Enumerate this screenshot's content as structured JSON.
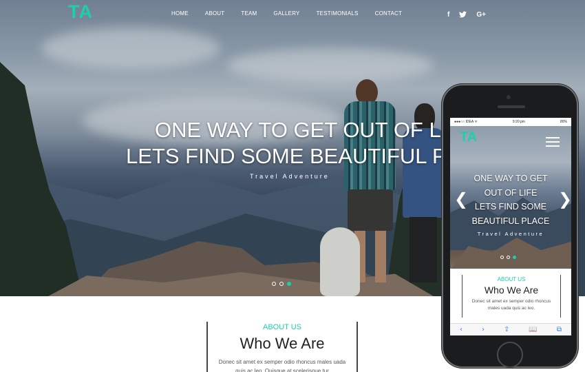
{
  "brand": {
    "logo": "TA",
    "accent": "#1dcfae"
  },
  "nav": {
    "items": [
      "HOME",
      "ABOUT",
      "TEAM",
      "GALLERY",
      "TESTIMONIALS",
      "CONTACT"
    ]
  },
  "social": {
    "facebook": "f",
    "twitter": "🐦",
    "googleplus": "G+"
  },
  "hero": {
    "line1": "ONE WAY TO GET OUT OF LIF",
    "line2": "LETS FIND SOME BEAUTIFUL PLA",
    "subtitle": "Travel Adventure",
    "slides": 3,
    "active_slide": 3
  },
  "about": {
    "label": "ABOUT US",
    "title": "Who We Are",
    "text": "Donec sit amet ex semper odio rhoncus males uada quis ac leo. Quisque at scelerisque tur"
  },
  "mobile": {
    "status": {
      "carrier": "●●●○○ IDEA ᯤ",
      "time": "9:20 pm",
      "battery": "80%"
    },
    "logo": "TA",
    "hero_lines": [
      "ONE WAY TO GET",
      "OUT OF LIFE",
      "LETS FIND SOME",
      "BEAUTIFUL PLACE"
    ],
    "subtitle": "Travel Adventure",
    "prev": "❮",
    "next": "❯",
    "about": {
      "label": "ABOUT US",
      "title": "Who We Are",
      "text": "Donec sit amet ex semper odio rhoncus males uada quis ac leo."
    },
    "toolbar": {
      "back": "‹",
      "forward": "›",
      "share": "⇪",
      "bookmarks": "📖",
      "tabs": "⧉"
    }
  }
}
